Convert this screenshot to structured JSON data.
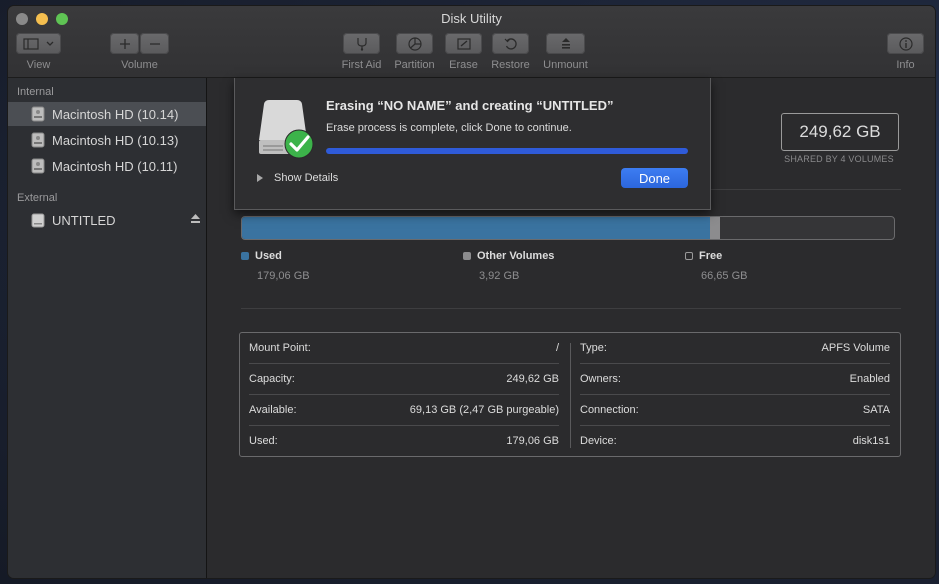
{
  "window": {
    "title": "Disk Utility"
  },
  "toolbar": {
    "view_label": "View",
    "volume_label": "Volume",
    "first_aid_label": "First Aid",
    "partition_label": "Partition",
    "erase_label": "Erase",
    "restore_label": "Restore",
    "unmount_label": "Unmount",
    "info_label": "Info"
  },
  "sidebar": {
    "internal_header": "Internal",
    "internal_items": [
      {
        "label": "Macintosh HD (10.14)"
      },
      {
        "label": "Macintosh HD (10.13)"
      },
      {
        "label": "Macintosh HD (10.11)"
      }
    ],
    "external_header": "External",
    "external_items": [
      {
        "label": "UNTITLED"
      }
    ]
  },
  "volume": {
    "capacity": "249,62 GB",
    "shared_label": "SHARED BY 4 VOLUMES"
  },
  "usage": {
    "used_fraction": 0.7173,
    "other_fraction": 0.0157,
    "colors": {
      "used": "#3a73a0",
      "other": "#8c8c8e",
      "free": "#353537"
    },
    "used": {
      "name": "Used",
      "value": "179,06 GB"
    },
    "other": {
      "name": "Other Volumes",
      "value": "3,92 GB"
    },
    "free": {
      "name": "Free",
      "value": "66,65 GB"
    }
  },
  "info": {
    "left": [
      {
        "key": "Mount Point:",
        "value": "/"
      },
      {
        "key": "Capacity:",
        "value": "249,62 GB"
      },
      {
        "key": "Available:",
        "value": "69,13 GB (2,47 GB purgeable)"
      },
      {
        "key": "Used:",
        "value": "179,06 GB"
      }
    ],
    "right": [
      {
        "key": "Type:",
        "value": "APFS Volume"
      },
      {
        "key": "Owners:",
        "value": "Enabled"
      },
      {
        "key": "Connection:",
        "value": "SATA"
      },
      {
        "key": "Device:",
        "value": "disk1s1"
      }
    ]
  },
  "sheet": {
    "title": "Erasing “NO NAME” and creating “UNTITLED”",
    "message": "Erase process is complete, click Done to continue.",
    "progress": 1.0,
    "show_details_label": "Show Details",
    "done_label": "Done"
  }
}
